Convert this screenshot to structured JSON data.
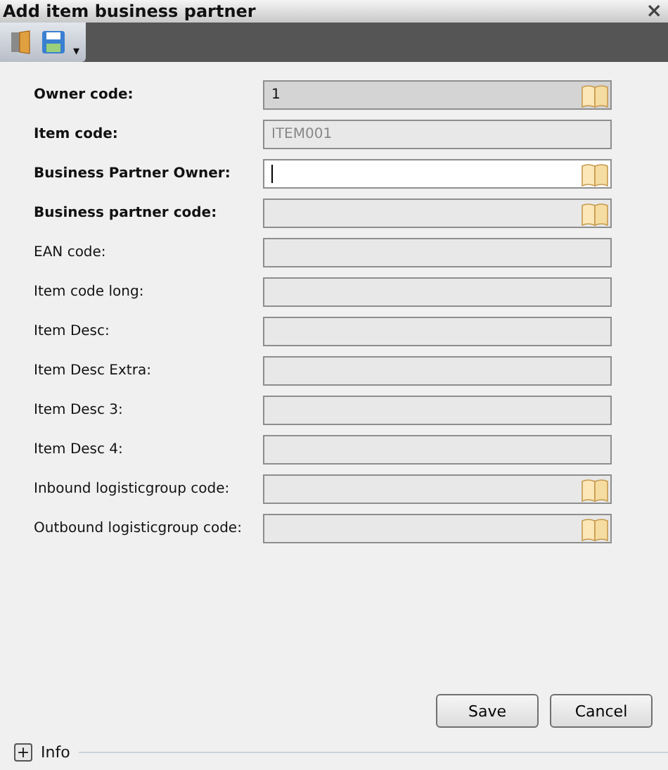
{
  "window": {
    "title": "Add item business partner",
    "close": "×"
  },
  "toolbar": {
    "more": "▾"
  },
  "fields": [
    {
      "label": "Owner code:",
      "bold": true,
      "value": "1",
      "kind": "readonly",
      "lookup": true
    },
    {
      "label": "Item code:",
      "bold": true,
      "value": "ITEM001",
      "kind": "disabled",
      "lookup": false
    },
    {
      "label": "Business Partner Owner:",
      "bold": true,
      "kind": "focused",
      "lookup": true
    },
    {
      "label": "Business partner code:",
      "bold": true,
      "kind": "disabled",
      "lookup": true
    },
    {
      "label": "EAN code:",
      "bold": false,
      "kind": "disabled",
      "lookup": false
    },
    {
      "label": "Item code long:",
      "bold": false,
      "kind": "disabled",
      "lookup": false
    },
    {
      "label": "Item Desc:",
      "bold": false,
      "kind": "disabled",
      "lookup": false
    },
    {
      "label": "Item Desc Extra:",
      "bold": false,
      "kind": "disabled",
      "lookup": false
    },
    {
      "label": "Item Desc 3:",
      "bold": false,
      "kind": "disabled",
      "lookup": false
    },
    {
      "label": "Item Desc 4:",
      "bold": false,
      "kind": "disabled",
      "lookup": false
    },
    {
      "label": "Inbound logisticgroup code:",
      "bold": false,
      "kind": "disabled",
      "lookup": true
    },
    {
      "label": "Outbound logisticgroup code:",
      "bold": false,
      "kind": "disabled",
      "lookup": true
    }
  ],
  "buttons": [
    "Save",
    "Cancel"
  ],
  "info": {
    "toggle": "+",
    "label": "Info",
    "expanded": false
  }
}
